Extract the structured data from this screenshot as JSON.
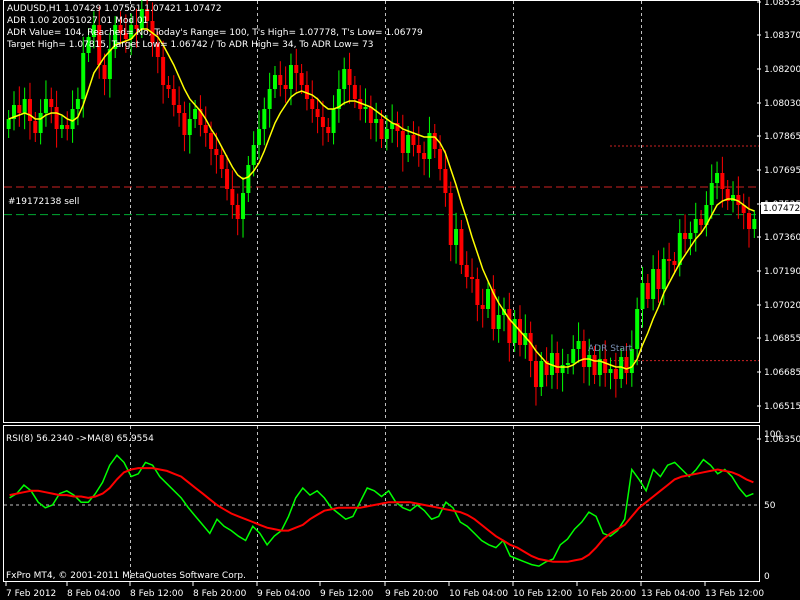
{
  "header": {
    "symbol_line": "AUDUSD,H1  1.07429 1.07551 1.07421 1.07472",
    "indicator_line": "ADR 1.00 20051027 01 Mod 01",
    "adr_line": "ADR Value= 104, Reached= No, Today's Range= 100, T's High= 1.07778, T's Low= 1.06779",
    "target_line": "Target High= 1.07815, Target Low= 1.06742 / To ADR High= 34, To ADR Low= 73"
  },
  "order_label": "#19172138 sell",
  "adr_start_label": "ADR Start",
  "rsi_label": "RSI(8) 56.2340  ->MA(8) 65.9554",
  "copyright": "FxPro MT4, © 2001-2011 MetaQuotes Software Corp.",
  "colors": {
    "bull": "#00ff00",
    "bear": "#ff0000",
    "ma": "#ffff00",
    "rsi": "#00ff00",
    "rsi_ma": "#ff0000",
    "grid": "#c0c0c0",
    "target_line": "#cc2222",
    "order_line": "#00aa33",
    "adr_line": "#cc2222"
  },
  "chart_data": [
    {
      "type": "candlestick",
      "title": "AUDUSD,H1",
      "ylim": [
        1.0644,
        1.08535
      ],
      "y_ticks": [
        "1.08535",
        "1.08370",
        "1.08200",
        "1.08030",
        "1.07865",
        "1.07695",
        "1.07525",
        "1.07360",
        "1.07190",
        "1.07020",
        "1.06855",
        "1.06685",
        "1.06515",
        "1.06350"
      ],
      "x_ticks": [
        "7 Feb 2012",
        "8 Feb 04:00",
        "8 Feb 12:00",
        "8 Feb 20:00",
        "9 Feb 04:00",
        "9 Feb 12:00",
        "9 Feb 20:00",
        "10 Feb 04:00",
        "10 Feb 12:00",
        "10 Feb 20:00",
        "13 Feb 04:00",
        "13 Feb 12:00"
      ],
      "current_price": "1.07472",
      "horizontal_levels": {
        "order_sell": 1.07472,
        "target_high": 1.07815,
        "target_low": 1.06742,
        "todays_high": 1.07778,
        "todays_low": 1.06779,
        "mid_level": 1.0761
      },
      "series": [
        {
          "name": "Candles",
          "close": [
            1.0795,
            1.0802,
            1.0798,
            1.0805,
            1.0794,
            1.0788,
            1.0798,
            1.0805,
            1.0801,
            1.079,
            1.0792,
            1.079,
            1.08,
            1.0805,
            1.0828,
            1.0836,
            1.0842,
            1.0822,
            1.0815,
            1.083,
            1.0842,
            1.0838,
            1.0835,
            1.0842,
            1.084,
            1.085,
            1.0844,
            1.0833,
            1.0826,
            1.0812,
            1.081,
            1.0802,
            1.0798,
            1.0787,
            1.0795,
            1.08,
            1.0792,
            1.0788,
            1.078,
            1.0777,
            1.077,
            1.076,
            1.0752,
            1.0745,
            1.0758,
            1.0772,
            1.0782,
            1.079,
            1.08,
            1.081,
            1.0817,
            1.0812,
            1.081,
            1.0822,
            1.0818,
            1.0812,
            1.0805,
            1.08,
            1.0796,
            1.0791,
            1.0788,
            1.08,
            1.081,
            1.082,
            1.0812,
            1.0805,
            1.08,
            1.0801,
            1.0793,
            1.0795,
            1.0785,
            1.079,
            1.0793,
            1.0789,
            1.0778,
            1.0787,
            1.0782,
            1.0778,
            1.0775,
            1.0788,
            1.078,
            1.077,
            1.0758,
            1.0732,
            1.074,
            1.0722,
            1.0716,
            1.0715,
            1.0702,
            1.07,
            1.071,
            1.069,
            1.0697,
            1.07,
            1.0683,
            1.0695,
            1.0682,
            1.0688,
            1.0674,
            1.0661,
            1.0674,
            1.0667,
            1.0678,
            1.0668,
            1.0672,
            1.0673,
            1.068,
            1.0684,
            1.0671,
            1.0677,
            1.0667,
            1.0675,
            1.0668,
            1.067,
            1.0665,
            1.0676,
            1.0668,
            1.068,
            1.07,
            1.0713,
            1.0705,
            1.072,
            1.071,
            1.0725,
            1.0724,
            1.0722,
            1.0738,
            1.0735,
            1.0738,
            1.0745,
            1.0742,
            1.0752,
            1.0763,
            1.0768,
            1.076,
            1.0754,
            1.0757,
            1.0752,
            1.0748,
            1.074,
            1.0745
          ],
          "open": [
            1.079,
            1.0795,
            1.0802,
            1.0798,
            1.0805,
            1.0794,
            1.0788,
            1.0798,
            1.0805,
            1.0801,
            1.079,
            1.0792,
            1.079,
            1.08,
            1.0805,
            1.0828,
            1.0836,
            1.0842,
            1.0822,
            1.0815,
            1.083,
            1.0842,
            1.0838,
            1.0835,
            1.0842,
            1.084,
            1.085,
            1.0844,
            1.0833,
            1.0826,
            1.0812,
            1.081,
            1.0802,
            1.0798,
            1.0787,
            1.0795,
            1.08,
            1.0792,
            1.0788,
            1.078,
            1.0777,
            1.077,
            1.076,
            1.0752,
            1.0745,
            1.0758,
            1.0772,
            1.0782,
            1.079,
            1.08,
            1.081,
            1.0817,
            1.0812,
            1.081,
            1.0822,
            1.0818,
            1.0812,
            1.0805,
            1.08,
            1.0796,
            1.0791,
            1.0788,
            1.08,
            1.081,
            1.082,
            1.0812,
            1.0805,
            1.08,
            1.0801,
            1.0793,
            1.0795,
            1.0785,
            1.079,
            1.0793,
            1.0789,
            1.0778,
            1.0787,
            1.0782,
            1.0778,
            1.0775,
            1.0788,
            1.078,
            1.077,
            1.0758,
            1.0732,
            1.074,
            1.0722,
            1.0716,
            1.0715,
            1.0702,
            1.07,
            1.071,
            1.069,
            1.0697,
            1.07,
            1.0683,
            1.0695,
            1.0682,
            1.0688,
            1.0674,
            1.0661,
            1.0674,
            1.0667,
            1.0678,
            1.0668,
            1.0672,
            1.0673,
            1.068,
            1.0684,
            1.0671,
            1.0677,
            1.0667,
            1.0675,
            1.0668,
            1.067,
            1.0665,
            1.0676,
            1.0668,
            1.068,
            1.07,
            1.0713,
            1.0705,
            1.072,
            1.071,
            1.0725,
            1.0724,
            1.0722,
            1.0738,
            1.0735,
            1.0738,
            1.0745,
            1.0742,
            1.0752,
            1.0763,
            1.0768,
            1.076,
            1.0754,
            1.0757,
            1.0752,
            1.0748,
            1.074
          ]
        },
        {
          "name": "MA",
          "values": [
            1.0795,
            1.0796,
            1.0797,
            1.0798,
            1.0797,
            1.0795,
            1.0795,
            1.0797,
            1.0798,
            1.0798,
            1.0797,
            1.0795,
            1.0794,
            1.0796,
            1.0802,
            1.081,
            1.0818,
            1.0822,
            1.0826,
            1.0829,
            1.0832,
            1.0833,
            1.0834,
            1.0835,
            1.0838,
            1.084,
            1.084,
            1.0838,
            1.0836,
            1.0832,
            1.0827,
            1.0822,
            1.0816,
            1.081,
            1.0805,
            1.0802,
            1.0799,
            1.0795,
            1.079,
            1.0786,
            1.0781,
            1.0776,
            1.0771,
            1.0767,
            1.0765,
            1.0766,
            1.0769,
            1.0773,
            1.0779,
            1.0786,
            1.0793,
            1.0798,
            1.0802,
            1.0806,
            1.0808,
            1.0809,
            1.0808,
            1.0807,
            1.0805,
            1.0802,
            1.08,
            1.08,
            1.0801,
            1.0803,
            1.0804,
            1.0804,
            1.0803,
            1.0802,
            1.0801,
            1.0799,
            1.0797,
            1.0795,
            1.0793,
            1.0792,
            1.079,
            1.0789,
            1.0788,
            1.0787,
            1.0786,
            1.0786,
            1.0786,
            1.0783,
            1.0778,
            1.077,
            1.0762,
            1.0753,
            1.0745,
            1.0736,
            1.0728,
            1.072,
            1.0714,
            1.0708,
            1.0703,
            1.0699,
            1.0695,
            1.0692,
            1.0689,
            1.0686,
            1.0683,
            1.0679,
            1.0676,
            1.0673,
            1.0672,
            1.0671,
            1.0671,
            1.0671,
            1.0672,
            1.0674,
            1.0675,
            1.0675,
            1.0674,
            1.0674,
            1.0673,
            1.0672,
            1.0671,
            1.0671,
            1.067,
            1.0671,
            1.0675,
            1.0682,
            1.0688,
            1.0695,
            1.0701,
            1.0708,
            1.0713,
            1.0718,
            1.0723,
            1.0727,
            1.0731,
            1.0735,
            1.0738,
            1.0742,
            1.0747,
            1.0752,
            1.0754,
            1.0755,
            1.0755,
            1.0754,
            1.0752,
            1.075,
            1.0749
          ]
        }
      ]
    },
    {
      "type": "line",
      "title": "RSI(8)",
      "ylim": [
        0,
        100
      ],
      "y_ticks": [
        "100",
        "50",
        "0"
      ],
      "levels": [
        50
      ],
      "series": [
        {
          "name": "RSI(8)",
          "values": [
            55,
            58,
            64,
            60,
            52,
            48,
            50,
            58,
            60,
            57,
            52,
            52,
            58,
            66,
            78,
            85,
            80,
            70,
            72,
            80,
            78,
            70,
            65,
            60,
            55,
            48,
            42,
            36,
            30,
            40,
            35,
            32,
            28,
            25,
            35,
            30,
            22,
            28,
            32,
            42,
            55,
            62,
            57,
            60,
            55,
            48,
            44,
            40,
            42,
            52,
            62,
            60,
            56,
            60,
            52,
            48,
            46,
            50,
            46,
            40,
            42,
            52,
            48,
            38,
            35,
            30,
            25,
            22,
            20,
            25,
            14,
            12,
            10,
            8,
            7,
            10,
            12,
            22,
            26,
            33,
            38,
            45,
            42,
            30,
            28,
            32,
            40,
            75,
            68,
            60,
            75,
            70,
            78,
            80,
            75,
            70,
            75,
            82,
            78,
            72,
            75,
            70,
            62,
            56,
            58
          ]
        },
        {
          "name": "MA(8)",
          "values": [
            57,
            58,
            59,
            60,
            60,
            59,
            58,
            57,
            57,
            56,
            56,
            55,
            56,
            58,
            62,
            68,
            73,
            75,
            76,
            76,
            76,
            75,
            74,
            72,
            70,
            66,
            62,
            58,
            54,
            50,
            47,
            44,
            42,
            40,
            38,
            36,
            34,
            33,
            32,
            32,
            34,
            36,
            40,
            43,
            46,
            47,
            48,
            48,
            48,
            48,
            49,
            50,
            51,
            52,
            52,
            52,
            52,
            51,
            50,
            49,
            48,
            47,
            46,
            45,
            43,
            40,
            36,
            32,
            28,
            25,
            22,
            20,
            17,
            14,
            12,
            11,
            10,
            10,
            10,
            11,
            12,
            15,
            20,
            26,
            30,
            33,
            36,
            42,
            48,
            52,
            56,
            60,
            64,
            68,
            70,
            71,
            72,
            73,
            74,
            75,
            74,
            73,
            71,
            68,
            66
          ]
        }
      ]
    }
  ]
}
